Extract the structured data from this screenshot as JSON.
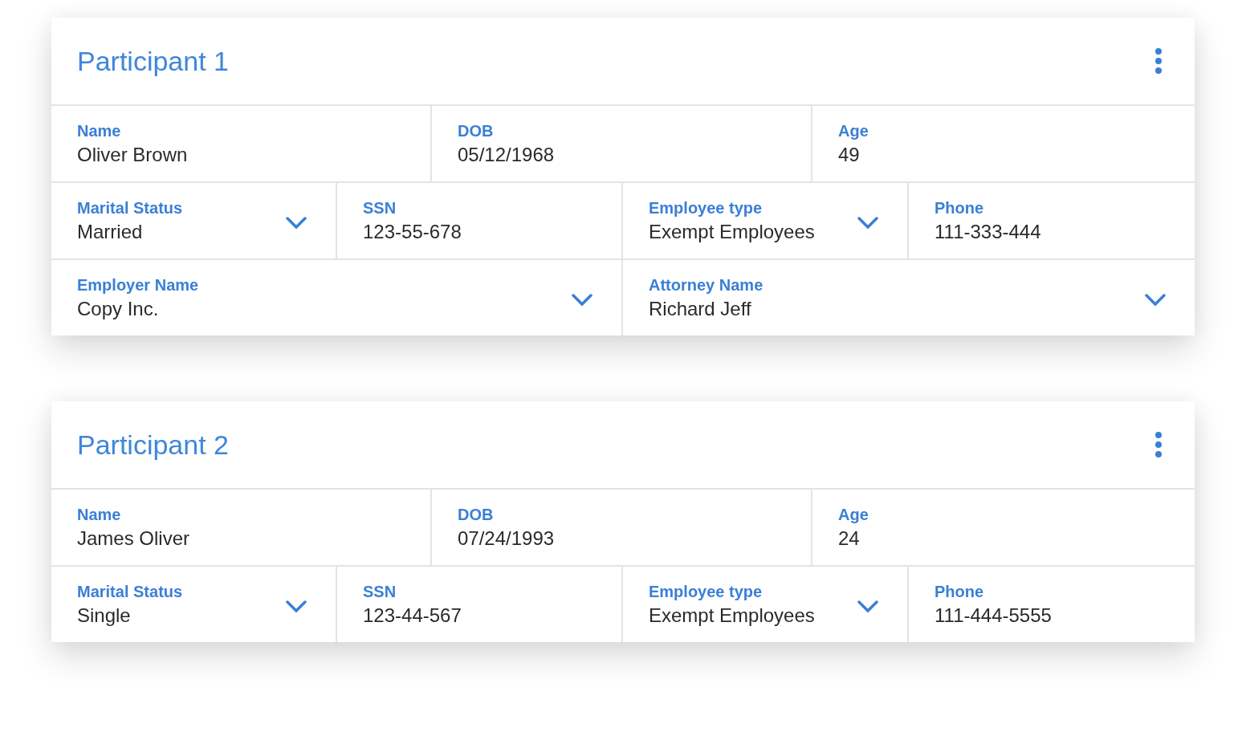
{
  "participants": [
    {
      "title": "Participant 1",
      "rows": [
        [
          {
            "label": "Name",
            "value": "Oliver Brown",
            "kind": "text"
          },
          {
            "label": "DOB",
            "value": "05/12/1968",
            "kind": "text"
          },
          {
            "label": "Age",
            "value": "49",
            "kind": "text"
          }
        ],
        [
          {
            "label": "Marital Status",
            "value": "Married",
            "kind": "dropdown"
          },
          {
            "label": "SSN",
            "value": "123-55-678",
            "kind": "text"
          },
          {
            "label": "Employee type",
            "value": "Exempt Employees",
            "kind": "dropdown"
          },
          {
            "label": "Phone",
            "value": "111-333-444",
            "kind": "text"
          }
        ],
        [
          {
            "label": "Employer Name",
            "value": "Copy Inc.",
            "kind": "dropdown"
          },
          {
            "label": "Attorney Name",
            "value": "Richard Jeff",
            "kind": "dropdown"
          }
        ]
      ]
    },
    {
      "title": "Participant 2",
      "rows": [
        [
          {
            "label": "Name",
            "value": "James Oliver",
            "kind": "text"
          },
          {
            "label": "DOB",
            "value": "07/24/1993",
            "kind": "text"
          },
          {
            "label": "Age",
            "value": "24",
            "kind": "text"
          }
        ],
        [
          {
            "label": "Marital Status",
            "value": "Single",
            "kind": "dropdown"
          },
          {
            "label": "SSN",
            "value": "123-44-567",
            "kind": "text"
          },
          {
            "label": "Employee type",
            "value": "Exempt Employees",
            "kind": "dropdown"
          },
          {
            "label": "Phone",
            "value": "111-444-5555",
            "kind": "text"
          }
        ]
      ]
    }
  ]
}
